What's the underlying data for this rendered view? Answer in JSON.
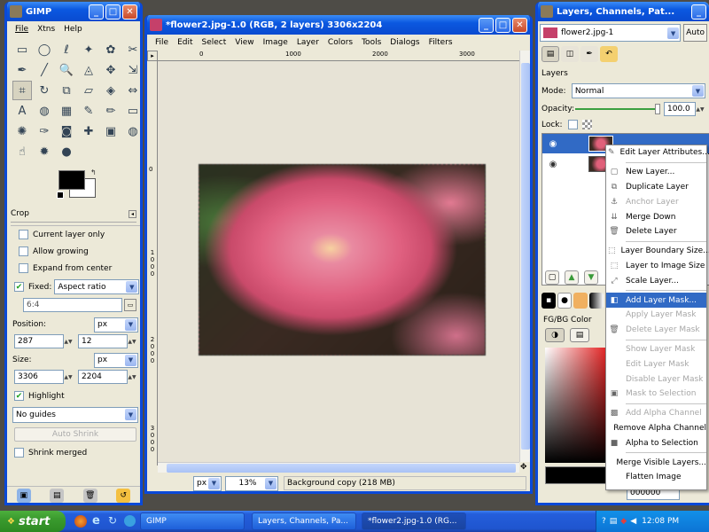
{
  "desktop": {
    "bg": "#4e4c47"
  },
  "toolbox": {
    "title": "GIMP",
    "menus": [
      "File",
      "Xtns",
      "Help"
    ],
    "tools": [
      "rect-select-icon",
      "ellipse-select-icon",
      "lasso-icon",
      "fuzzy-select-icon",
      "color-select-icon",
      "scissors-icon",
      "paths-icon",
      "color-picker-icon",
      "zoom-icon",
      "measure-icon",
      "move-icon",
      "align-icon",
      "crop-icon",
      "rotate-icon",
      "scale-icon",
      "shear-icon",
      "perspective-icon",
      "flip-icon",
      "text-icon",
      "bucket-fill-icon",
      "blend-icon",
      "pencil-icon",
      "paintbrush-icon",
      "eraser-icon",
      "airbrush-icon",
      "ink-icon",
      "clone-icon",
      "heal-icon",
      "perspective-clone-icon",
      "smudge-icon",
      "blur-icon",
      "dodge-icon",
      "burn-icon"
    ],
    "tool_glyphs": [
      "▭",
      "◯",
      "ℓ",
      "✦",
      "✿",
      "✂",
      "✒",
      "╱",
      "🔍",
      "◬",
      "✥",
      "⇲",
      "⌗",
      "↻",
      "⧉",
      "▱",
      "◈",
      "⇔",
      "A",
      "◍",
      "▦",
      "✎",
      "✏",
      "▭",
      "✺",
      "✑",
      "◙",
      "✚",
      "▣",
      "◍",
      "☝",
      "✹",
      "●"
    ],
    "panel_title": "Crop",
    "options": {
      "current_layer_only": "Current layer only",
      "allow_growing": "Allow growing",
      "expand_from_center": "Expand from center",
      "fixed": "Fixed:",
      "fixed_value": "Aspect ratio",
      "ratio": "6:4",
      "position_label": "Position:",
      "position_unit": "px",
      "pos_x": "287",
      "pos_y": "12",
      "size_label": "Size:",
      "size_unit": "px",
      "size_w": "3306",
      "size_h": "2204",
      "highlight": "Highlight",
      "guides": "No guides",
      "auto_shrink": "Auto Shrink",
      "shrink_merged": "Shrink merged"
    }
  },
  "image_window": {
    "title": "*flower2.jpg-1.0 (RGB, 2 layers) 3306x2204",
    "menus": [
      "File",
      "Edit",
      "Select",
      "View",
      "Image",
      "Layer",
      "Colors",
      "Tools",
      "Dialogs",
      "Filters"
    ],
    "ruler_h": [
      "0",
      "1000",
      "2000",
      "3000"
    ],
    "ruler_v": [
      "1000",
      "2000"
    ],
    "ruler_v_0": "0",
    "ruler_v_3000": "3000",
    "unit": "px",
    "zoom": "13%",
    "status": "Background copy (218 MB)"
  },
  "layers_window": {
    "title": "Layers, Channels, Pat...",
    "image": "flower2.jpg-1",
    "auto_btn": "Auto",
    "section": "Layers",
    "mode_label": "Mode:",
    "mode_value": "Normal",
    "opacity_label": "Opacity:",
    "opacity_value": "100.0",
    "lock_label": "Lock:",
    "fgbg_label": "FG/BG Color",
    "hex_value": "000000"
  },
  "context_menu": {
    "groups": [
      [
        {
          "label": "Edit Layer Attributes...",
          "icon": "layer-attributes-icon",
          "glyph": "✎",
          "enabled": true
        }
      ],
      [
        {
          "label": "New Layer...",
          "icon": "new-layer-icon",
          "glyph": "▢",
          "enabled": true
        },
        {
          "label": "Duplicate Layer",
          "icon": "duplicate-layer-icon",
          "glyph": "⧉",
          "enabled": true
        },
        {
          "label": "Anchor Layer",
          "icon": "anchor-icon",
          "glyph": "⚓",
          "enabled": false
        },
        {
          "label": "Merge Down",
          "icon": "merge-down-icon",
          "glyph": "⇊",
          "enabled": true
        },
        {
          "label": "Delete Layer",
          "icon": "delete-layer-icon",
          "glyph": "🗑",
          "enabled": true
        }
      ],
      [
        {
          "label": "Layer Boundary Size...",
          "icon": "boundary-size-icon",
          "glyph": "⬚",
          "enabled": true
        },
        {
          "label": "Layer to Image Size",
          "icon": "layer-to-image-icon",
          "glyph": "⬚",
          "enabled": true
        },
        {
          "label": "Scale Layer...",
          "icon": "scale-layer-icon",
          "glyph": "⤢",
          "enabled": true
        }
      ],
      [
        {
          "label": "Add Layer Mask...",
          "icon": "add-mask-icon",
          "glyph": "◧",
          "enabled": true,
          "highlighted": true
        },
        {
          "label": "Apply Layer Mask",
          "icon": "",
          "glyph": "",
          "enabled": false
        },
        {
          "label": "Delete Layer Mask",
          "icon": "delete-mask-icon",
          "glyph": "🗑",
          "enabled": false
        }
      ],
      [
        {
          "label": "Show Layer Mask",
          "icon": "",
          "glyph": "",
          "enabled": false
        },
        {
          "label": "Edit Layer Mask",
          "icon": "",
          "glyph": "",
          "enabled": false
        },
        {
          "label": "Disable Layer Mask",
          "icon": "",
          "glyph": "",
          "enabled": false
        },
        {
          "label": "Mask to Selection",
          "icon": "mask-selection-icon",
          "glyph": "▣",
          "enabled": false
        }
      ],
      [
        {
          "label": "Add Alpha Channel",
          "icon": "alpha-icon",
          "glyph": "▩",
          "enabled": false
        },
        {
          "label": "Remove Alpha Channel",
          "icon": "",
          "glyph": "",
          "enabled": true
        },
        {
          "label": "Alpha to Selection",
          "icon": "alpha-selection-icon",
          "glyph": "■",
          "enabled": true
        }
      ],
      [
        {
          "label": "Merge Visible Layers...",
          "icon": "",
          "glyph": "",
          "enabled": true
        },
        {
          "label": "Flatten Image",
          "icon": "",
          "glyph": "",
          "enabled": true
        }
      ]
    ]
  },
  "taskbar": {
    "start": "start",
    "tasks": [
      "GIMP",
      "Layers, Channels, Pa...",
      "*flower2.jpg-1.0 (RG..."
    ],
    "clock": "12:08 PM"
  }
}
